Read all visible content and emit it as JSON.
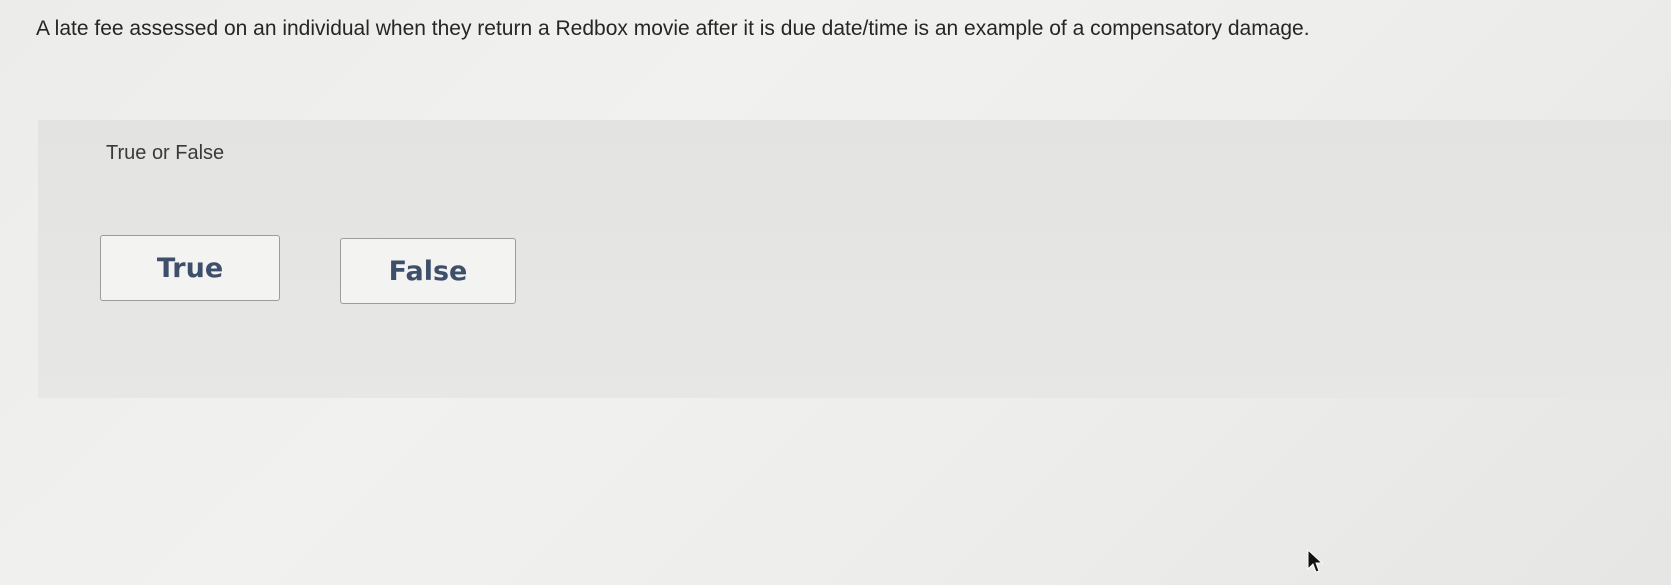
{
  "question": {
    "text": "A late fee assessed on an individual when they return a Redbox movie after it is due date/time is an example of a compensatory damage."
  },
  "panel": {
    "label": "True or False",
    "choices": [
      {
        "label": "True"
      },
      {
        "label": "False"
      }
    ]
  },
  "cursor": {
    "icon": "mouse-pointer-icon"
  }
}
